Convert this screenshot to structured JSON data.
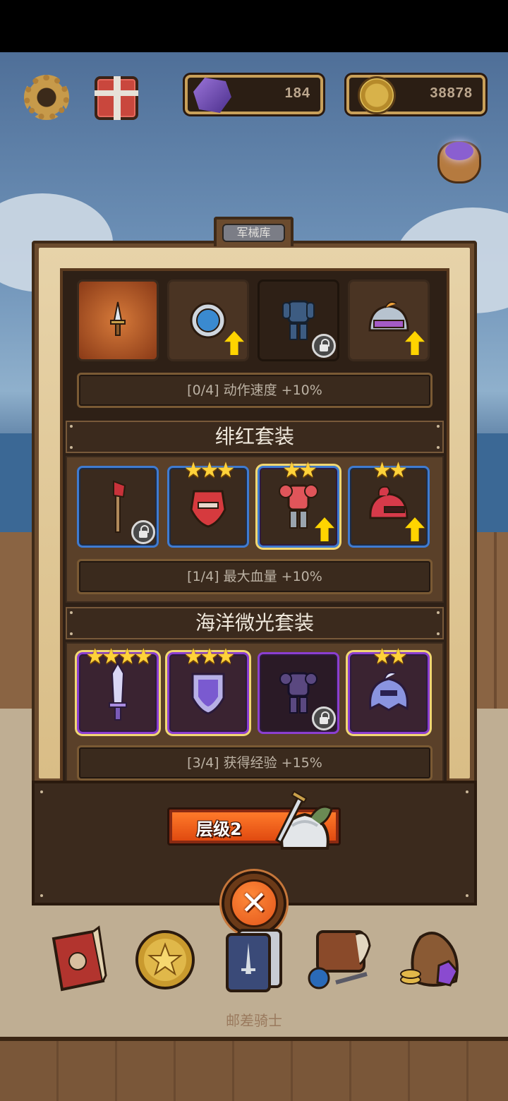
{
  "hud": {
    "settings_icon": "gear-icon",
    "gift_icon": "gift-icon",
    "gems_value": "184",
    "gold_value": "38878"
  },
  "panel": {
    "tab_label": "军械库"
  },
  "sets": [
    {
      "title": "",
      "bonus": "[0/4] 动作速度 +10%",
      "items": [
        {
          "icon": "dagger-icon",
          "stars": "",
          "locked": false,
          "upgrade": false
        },
        {
          "icon": "round-shield-icon",
          "stars": "",
          "locked": false,
          "upgrade": true
        },
        {
          "icon": "armor-icon",
          "stars": "",
          "locked": true,
          "upgrade": false
        },
        {
          "icon": "helmet-icon",
          "stars": "",
          "locked": false,
          "upgrade": true
        }
      ]
    },
    {
      "title": "绯红套装",
      "bonus": "[1/4] 最大血量 +10%",
      "items": [
        {
          "icon": "crimson-axe-icon",
          "stars": "",
          "locked": true,
          "upgrade": false
        },
        {
          "icon": "crimson-shield-icon",
          "stars": "★★★",
          "locked": false,
          "upgrade": false
        },
        {
          "icon": "crimson-armor-icon",
          "stars": "★★",
          "locked": false,
          "upgrade": true
        },
        {
          "icon": "crimson-helmet-icon",
          "stars": "★★",
          "locked": false,
          "upgrade": true
        }
      ]
    },
    {
      "title": "海洋微光套装",
      "bonus": "[3/4] 获得经验 +15%",
      "items": [
        {
          "icon": "ocean-sword-icon",
          "stars": "★★★★",
          "locked": false,
          "upgrade": false
        },
        {
          "icon": "ocean-shield-icon",
          "stars": "★★★",
          "locked": false,
          "upgrade": false
        },
        {
          "icon": "ocean-armor-icon",
          "stars": "",
          "locked": true,
          "upgrade": false
        },
        {
          "icon": "ocean-helmet-icon",
          "stars": "★★",
          "locked": false,
          "upgrade": false
        }
      ]
    }
  ],
  "tier": {
    "label": "层级2"
  },
  "bottom_nav": {
    "items": [
      "book-icon",
      "star-coin-icon",
      "card-deck-icon",
      "backpack-icon",
      "treasure-bag-icon"
    ],
    "title": "邮差骑士"
  },
  "colors": {
    "star": "#ffd23a",
    "blue_border": "#3f7bd1",
    "purple_border": "#8b3fd1",
    "tier_button": "#f0621c"
  }
}
